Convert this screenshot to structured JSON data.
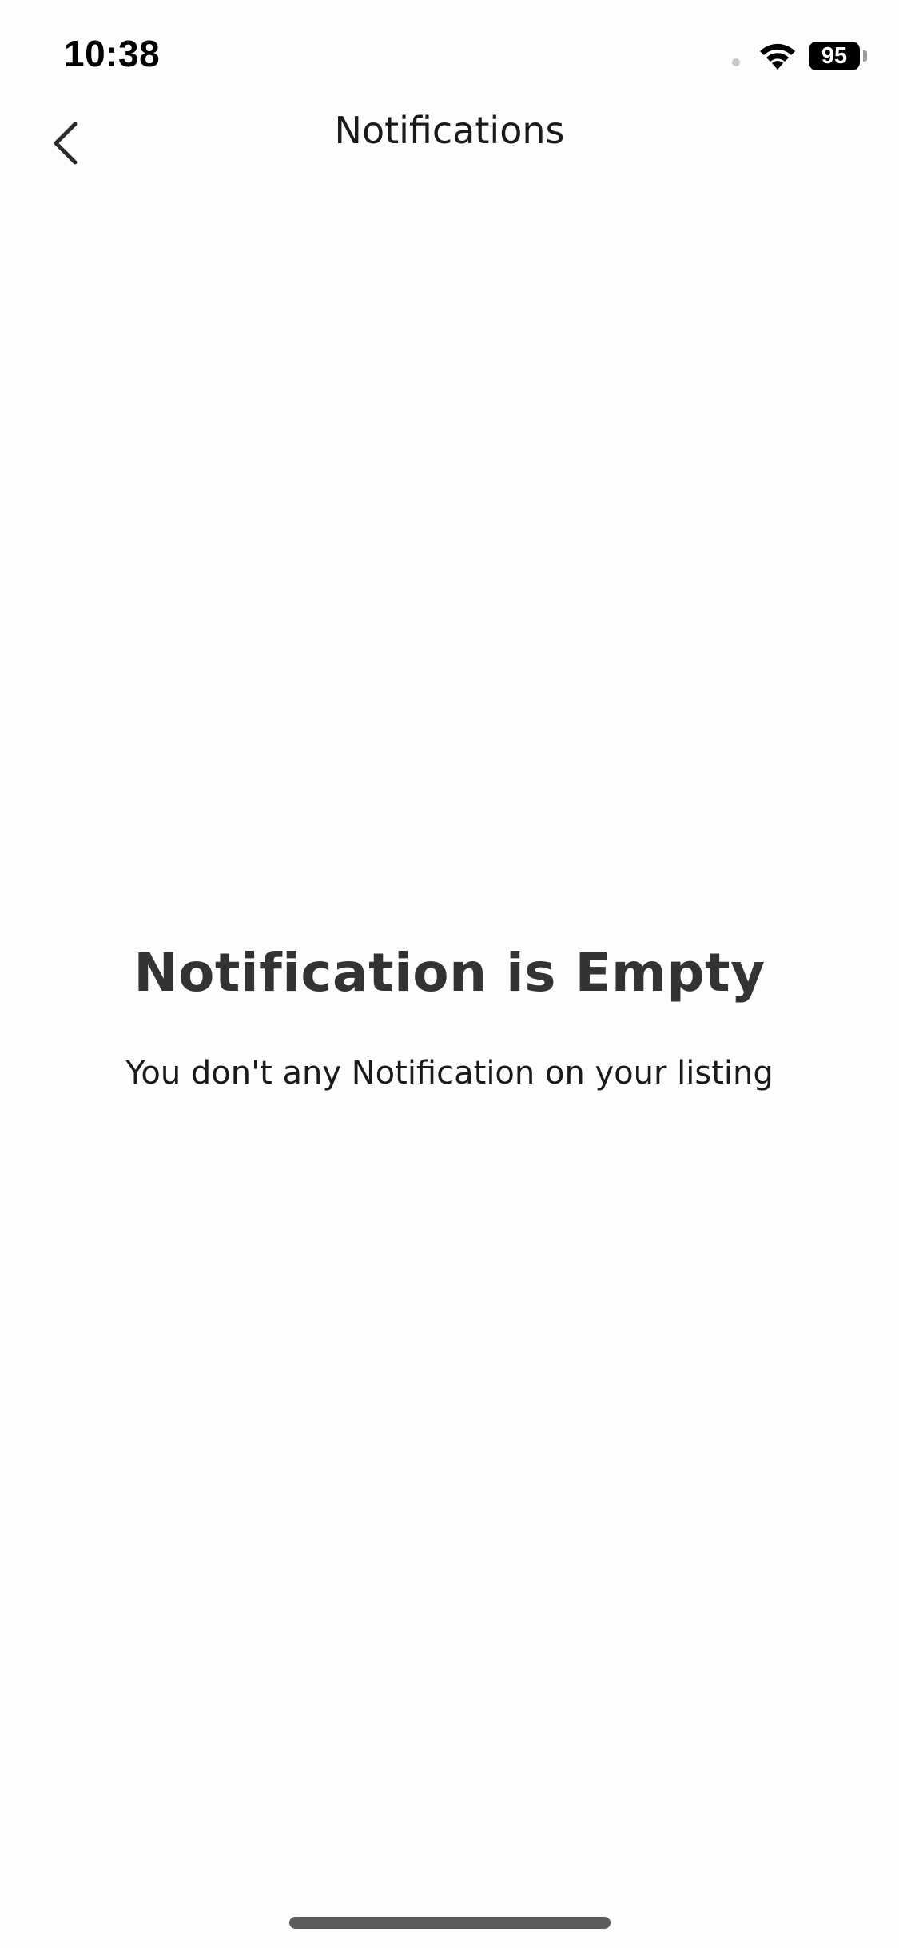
{
  "status_bar": {
    "time": "10:38",
    "battery_level": "95"
  },
  "header": {
    "title": "Notifications",
    "back_icon": "chevron-left-icon"
  },
  "empty_state": {
    "title": "Notification is Empty",
    "message": "You don't any Notification on your listing"
  },
  "colors": {
    "background": "#fdfdfd",
    "title_text": "#333333",
    "body_text": "#1a1a1a"
  }
}
